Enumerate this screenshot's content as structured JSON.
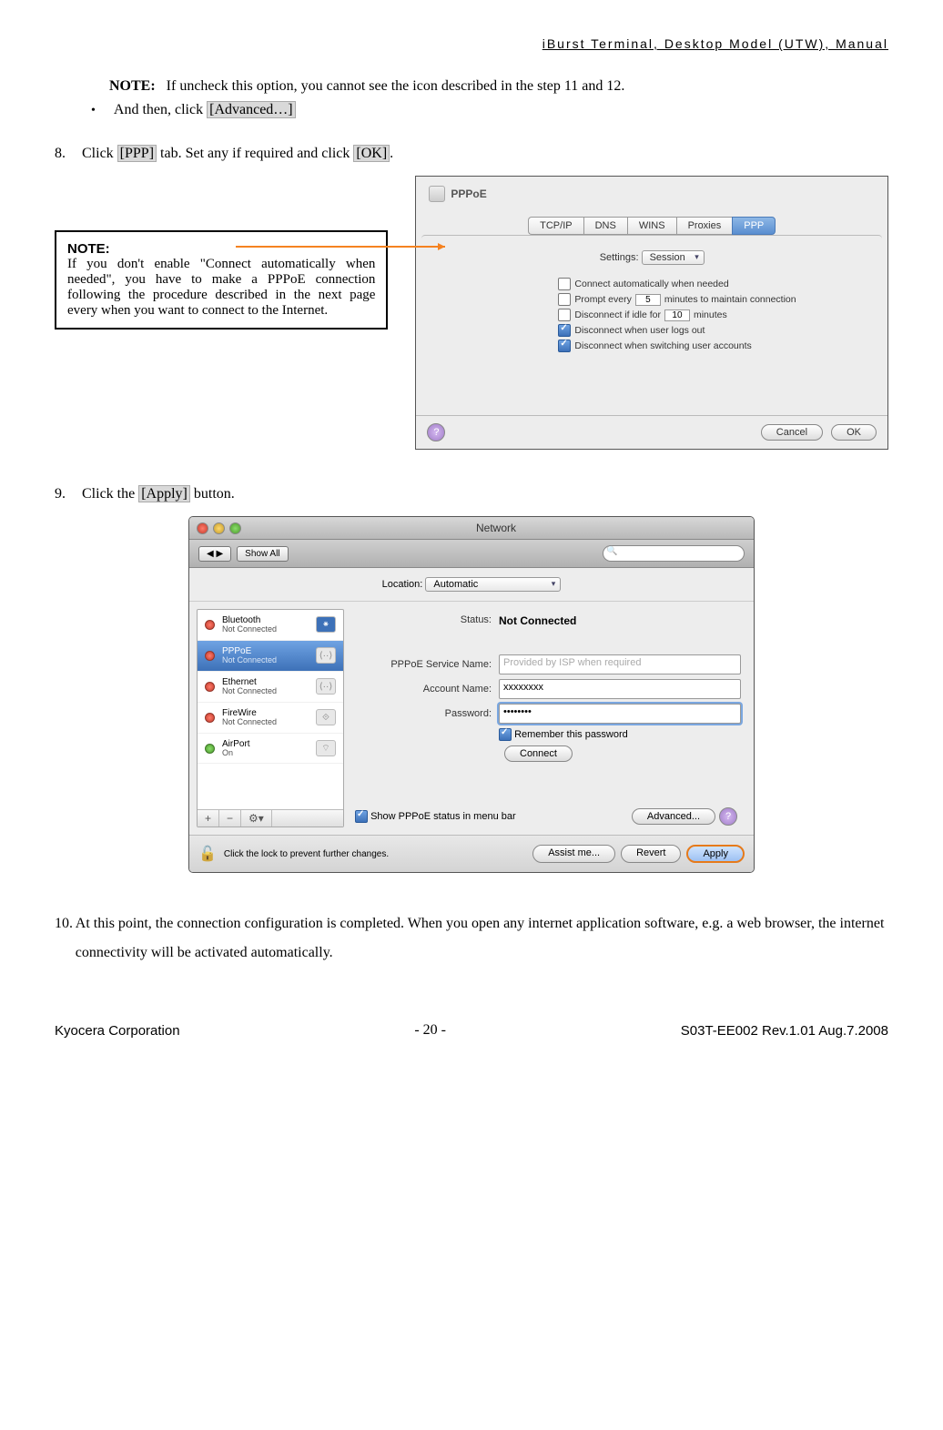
{
  "header": {
    "doc_title": "iBurst  Terminal,  Desktop  Model  (UTW),  Manual"
  },
  "line_note": {
    "label": "NOTE:",
    "text": "If uncheck this option, you cannot see the icon described in the step 11 and 12."
  },
  "bullet": {
    "prefix": "And then, click ",
    "btn": "[Advanced…]"
  },
  "step8": {
    "num": "8.",
    "pre": "Click ",
    "tab": "[PPP]",
    "mid": " tab. Set any if required and click ",
    "ok": "[OK]",
    "suf": "."
  },
  "note_box": {
    "title": "NOTE:",
    "body": "If you don't enable \"Connect automatically when needed\", you have to make a PPPoE connection following the procedure described in the next page every when you want to connect to the Internet."
  },
  "ppp": {
    "title": "PPPoE",
    "tabs": [
      "TCP/IP",
      "DNS",
      "WINS",
      "Proxies",
      "PPP"
    ],
    "settings_label": "Settings:",
    "settings_value": "Session",
    "opts": {
      "connect_auto": "Connect automatically when needed",
      "prompt_pre": "Prompt every",
      "prompt_val": "5",
      "prompt_suf": "minutes to maintain connection",
      "idle_pre": "Disconnect if idle for",
      "idle_val": "10",
      "idle_suf": "minutes",
      "logout": "Disconnect when user logs out",
      "switch": "Disconnect when switching user accounts"
    },
    "cancel": "Cancel",
    "ok": "OK"
  },
  "step9": {
    "num": "9.",
    "pre": "Click the ",
    "btn": "[Apply]",
    "suf": " button."
  },
  "net": {
    "title": "Network",
    "back": "◀ ▶",
    "show_all": "Show All",
    "loc_label": "Location:",
    "loc_value": "Automatic",
    "side": [
      {
        "name": "Bluetooth",
        "sub": "Not Connected",
        "color": "red",
        "ic": "bt",
        "glyph": "⁕"
      },
      {
        "name": "PPPoE",
        "sub": "Not Connected",
        "color": "red",
        "ic": "arrows",
        "glyph": "⟨··⟩",
        "sel": true
      },
      {
        "name": "Ethernet",
        "sub": "Not Connected",
        "color": "red",
        "ic": "arrows",
        "glyph": "⟨··⟩"
      },
      {
        "name": "FireWire",
        "sub": "Not Connected",
        "color": "red",
        "ic": "plain",
        "glyph": "⟐"
      },
      {
        "name": "AirPort",
        "sub": "On",
        "color": "grn",
        "ic": "plain",
        "glyph": "⌔"
      }
    ],
    "plus": "+",
    "minus": "−",
    "gear": "⚙︎▾",
    "status_label": "Status:",
    "status_value": "Not Connected",
    "svc_label": "PPPoE Service Name:",
    "svc_ph": "Provided by ISP when required",
    "acct_label": "Account Name:",
    "acct_val": "xxxxxxxx",
    "pwd_label": "Password:",
    "pwd_val": "••••••••",
    "remember": "Remember this password",
    "connect": "Connect",
    "show_status": "Show PPPoE status in menu bar",
    "advanced": "Advanced...",
    "lock_text": "Click the lock to prevent further changes.",
    "assist": "Assist me...",
    "revert": "Revert",
    "apply": "Apply"
  },
  "step10": {
    "num": "10.",
    "text": "At this point, the connection configuration is completed. When you open any internet application software, e.g. a web browser, the internet connectivity will be activated automatically."
  },
  "footer": {
    "left": "Kyocera Corporation",
    "center": "- 20 -",
    "right": "S03T-EE002 Rev.1.01 Aug.7.2008"
  }
}
